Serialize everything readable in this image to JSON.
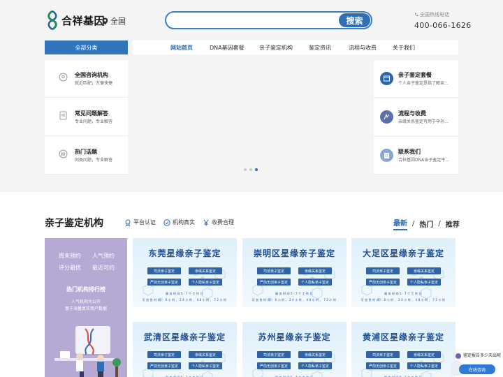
{
  "header": {
    "logo_text": "合祥基因",
    "location": "全国",
    "search_placeholder": "",
    "search_button": "搜索",
    "hotline_label": "全国热线电话",
    "hotline_number": "400-066-1626"
  },
  "nav": {
    "category_button": "全部分类",
    "items": [
      "网站首页",
      "DNA基因套餐",
      "亲子鉴定机构",
      "鉴定资讯",
      "流程与收费",
      "关于我们"
    ]
  },
  "left_cards": [
    {
      "title": "全国咨询机构",
      "desc": "就近匹配，方便快捷",
      "icon": "location-pin-icon"
    },
    {
      "title": "常见问题解答",
      "desc": "专业问题，专业解答",
      "icon": "document-icon"
    },
    {
      "title": "热门话题",
      "desc": "同类问题，专业解答",
      "icon": "hashtag-icon"
    }
  ],
  "right_cards": [
    {
      "title": "亲子鉴定套餐",
      "desc": "个人亲子鉴定是指了解亲...",
      "icon": "package-icon"
    },
    {
      "title": "流程与收费",
      "desc": "亲缘关系鉴定可用于孕孙...",
      "icon": "flow-icon"
    },
    {
      "title": "联系我们",
      "desc": "合祥基因DNA亲子鉴定平...",
      "icon": "building-icon"
    }
  ],
  "section": {
    "title": "亲子鉴定机构",
    "badges": [
      {
        "label": "平台认证",
        "icon": "certified-icon"
      },
      {
        "label": "机构真实",
        "icon": "check-circle-icon"
      },
      {
        "label": "收费合理",
        "icon": "yen-icon"
      }
    ],
    "tabs": [
      "最新",
      "热门",
      "推荐"
    ],
    "active_tab": "最新"
  },
  "promo": {
    "grid": [
      "周末预约",
      "人气预约",
      "评分最优",
      "最近可约"
    ],
    "title": "热门机构排行榜",
    "sub1": "人气机构大公开",
    "sub2": "基于海量真实用户数据"
  },
  "cards": [
    {
      "title": "东莞星缘亲子鉴定"
    },
    {
      "title": "崇明区星缘亲子鉴定"
    },
    {
      "title": "大足区星缘亲子鉴定"
    },
    {
      "title": "武清区星缘亲子鉴定"
    },
    {
      "title": "苏州星缘亲子鉴定"
    },
    {
      "title": "黄浦区星缘亲子鉴定"
    }
  ],
  "card_common": {
    "pill1": "司法亲子鉴定",
    "pill2": "亲缘关系鉴定",
    "pill3": "严前无创亲子鉴定",
    "pill4": "个人隐私亲子鉴定",
    "meta1": "服务时间5-7个工作日",
    "meta2": "可加急时间：6小时、24小时、48小时、72小时"
  },
  "chat": {
    "message": "鉴定报告多少天出呢",
    "button": "在线咨询"
  },
  "colors": {
    "primary": "#2f6fb5",
    "nav_blue": "#3176ba",
    "promo_purple": "#b6a9d4",
    "card_title": "#1f4f93"
  }
}
